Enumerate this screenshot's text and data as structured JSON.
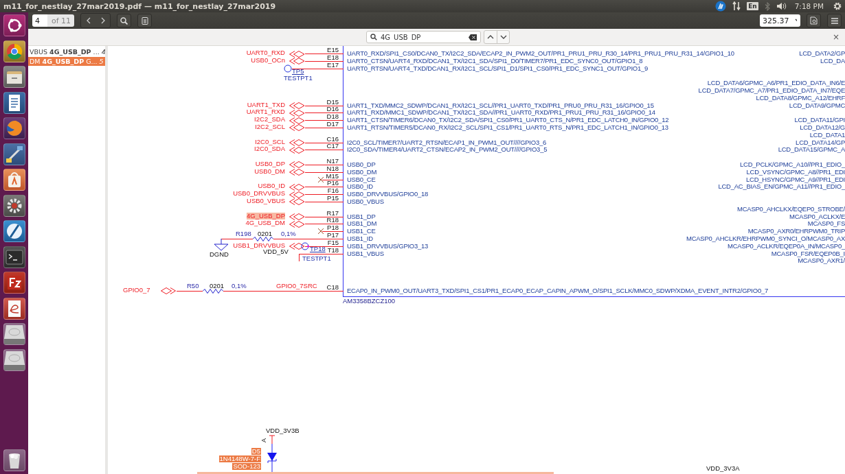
{
  "window": {
    "title": "m11_for_nestlay_27mar2019.pdf — m11_for_nestlay_27mar2019"
  },
  "indicators": {
    "keyboard": "En",
    "clock": "7:18 PM"
  },
  "toolbar": {
    "page": "4",
    "page_count": "of 11",
    "zoom": "325.37"
  },
  "find_bar": {
    "query": "4G_USB_DP",
    "close": "×"
  },
  "results": [
    {
      "text": "VBUS **4G_USB_DP** ...",
      "page": "4",
      "selected": false
    },
    {
      "text": "DM **4G_USB_DP** G...",
      "page": "5",
      "selected": true
    }
  ],
  "schematic": {
    "rows": [
      {
        "kind": "net",
        "net": "UART0_RXD",
        "search_match": false,
        "pin": "E15",
        "pin_name": "UART0_RXD/SPI1_CS0/DCAN0_TX/I2C2_SDA/ECAP2_IN_PWM2_OUT/PR1_PRU1_PRU_R30_14/PR1_PRU1_PRU_R31_14/GPIO1_10",
        "right": "LCD_DATA2/GP"
      },
      {
        "kind": "net",
        "net": "USB0_OCn",
        "search_match": false,
        "pin": "E18",
        "pin_name": "UART0_CTSN/UART4_RXD/DCAN1_TX/I2C1_SDA/SPI1_D0/TIMER7/PR1_EDC_SYNC0_OUT/GPIO1_8",
        "right": "LCD_DA"
      },
      {
        "kind": "testpoint",
        "testpoint": "TP5",
        "testpoint_type": "TESTPT1",
        "pin": "E17",
        "pin_name": "UART0_RTSN/UART4_TXD/DCAN1_RX/I2C1_SCL/SPI1_D1/SPI1_CS0/PR1_EDC_SYNC1_OUT/GPIO1_9"
      },
      {
        "kind": "blank"
      },
      {
        "kind": "blank",
        "right": "LCD_DATA6/GPMC_A6/PR1_EDIO_DATA_IN6/E"
      },
      {
        "kind": "blank",
        "right": "LCD_DATA7/GPMC_A7/PR1_EDIO_DATA_IN7/EQE"
      },
      {
        "kind": "blank",
        "right": "LCD_DATA8/GPMC_A12/EHRF"
      },
      {
        "kind": "net",
        "net": "UART1_TXD",
        "search_match": false,
        "pin": "D15",
        "pin_name": "UART1_TXD/MMC2_SDWP/DCAN1_RX/I2C1_SCL//PR1_UART0_TXD/PR1_PRU0_PRU_R31_16/GPIO0_15",
        "right": "LCD_DATA9/GPMC"
      },
      {
        "kind": "net",
        "net": "UART1_RXD",
        "search_match": false,
        "pin": "D16",
        "pin_name": "UART1_RXD/MMC1_SDWP/DCAN1_TX/I2C1_SDA//PR1_UART0_RXD/PR1_PRU1_PRU_R31_16/GPIO0_14"
      },
      {
        "kind": "net",
        "net": "I2C2_SDA",
        "search_match": false,
        "pin": "D18",
        "pin_name": "UART1_CTSN/TIMER6/DCAN0_TX/I2C2_SDA/SPI1_CS0/PR1_UART0_CTS_N/PR1_EDC_LATCH0_IN/GPIO0_12",
        "right": "LCD_DATA11/GPI"
      },
      {
        "kind": "net",
        "net": "I2C2_SCL",
        "search_match": false,
        "pin": "D17",
        "pin_name": "UART1_RTSN/TIMER5/DCAN0_RX/I2C2_SCL/SPI1_CS1/PR1_UART0_RTS_N/PR1_EDC_LATCH1_IN/GPIO0_13",
        "right": "LCD_DATA12/G"
      },
      {
        "kind": "blank",
        "right": "LCD_DATA1"
      },
      {
        "kind": "net",
        "net": "I2C0_SCL",
        "search_match": false,
        "pin": "C16",
        "pin_name": "I2C0_SCL/TIMER7/UART2_RTSN/ECAP1_IN_PWM1_OUT////GPIO3_6",
        "right": "LCD_DATA14/GP"
      },
      {
        "kind": "net",
        "net": "I2C0_SDA",
        "search_match": false,
        "pin": "C17",
        "pin_name": "I2C0_SDA/TIMER4/UART2_CTSN/ECAP2_IN_PWM2_OUT////GPIO3_5",
        "right": "LCD_DATA15/GPMC_A"
      },
      {
        "kind": "blank"
      },
      {
        "kind": "net",
        "net": "USB0_DP",
        "search_match": false,
        "pin": "N17",
        "pin_name": "USB0_DP",
        "right": "LCD_PCLK/GPMC_A10//PR1_EDIO_"
      },
      {
        "kind": "net",
        "net": "USB0_DM",
        "search_match": false,
        "pin": "N18",
        "pin_name": "USB0_DM",
        "right": "LCD_VSYNC/GPMC_A8//PR1_EDI"
      },
      {
        "kind": "nc",
        "pin": "M15",
        "pin_name": "USB0_CE",
        "right": "LCD_HSYNC/GPMC_A9//PR1_EDI"
      },
      {
        "kind": "net",
        "net": "USB0_ID",
        "search_match": false,
        "pin": "P16",
        "pin_name": "USB0_ID",
        "right": "LCD_AC_BIAS_EN/GPMC_A11//PR1_EDIO_"
      },
      {
        "kind": "net",
        "net": "USB0_DRVVBUS",
        "search_match": false,
        "pin": "F16",
        "pin_name": "USB0_DRVVBUS/GPIO0_18"
      },
      {
        "kind": "net",
        "net": "USB0_VBUS",
        "search_match": false,
        "pin": "P15",
        "pin_name": "USB0_VBUS"
      },
      {
        "kind": "blank",
        "right": "MCASP0_AHCLKX/EQEP0_STROBE/"
      },
      {
        "kind": "net",
        "net": "4G_USB_DP",
        "search_match": true,
        "pin": "R17",
        "pin_name": "USB1_DP",
        "right": "MCASP0_ACLKX/E"
      },
      {
        "kind": "net",
        "net": "4G_USB_DM",
        "search_match": false,
        "pin": "R18",
        "pin_name": "USB1_DM",
        "right": "MCASP0_FS"
      },
      {
        "kind": "nc",
        "pin": "P18",
        "pin_name": "USB1_CE",
        "right": "MCASP0_AXR0/EHRPWM0_TRIP"
      },
      {
        "kind": "resistor",
        "resistor": {
          "ref": "R198",
          "package": "0201",
          "tolerance": "0,1%"
        },
        "ground": "DGND",
        "pin": "P17",
        "pin_name": "USB1_ID",
        "right": "MCASP0_AHCLKR/EHRPWM0_SYNCI_O/MCASP0_AX"
      },
      {
        "kind": "net",
        "net": "USB1_DRVVBUS",
        "search_match": false,
        "testpoint": "TP18",
        "pin": "F15",
        "pin_name": "USB1_DRVVBUS/GPIO3_13",
        "right": "MCASP0_ACLKR/EQEP0A_IN/MCASP0_"
      },
      {
        "kind": "stub",
        "supply": "VDD_5V",
        "testpoint_type": "TESTPT1",
        "pin": "T18",
        "pin_name": "USB1_VBUS",
        "right": "MCASP0_FSR/EQEP0B_I"
      },
      {
        "kind": "blank",
        "right": "MCASP0_AXR1/"
      },
      {
        "kind": "blank"
      },
      {
        "kind": "blank"
      },
      {
        "kind": "blank"
      },
      {
        "kind": "series_resistor",
        "net": "GPIO0_7",
        "resistor": {
          "ref": "R50",
          "package": "0201",
          "tolerance": "0,1%"
        },
        "signal": "GPIO0_7SRC",
        "pin": "C18",
        "pin_name": "ECAP0_IN_PWM0_OUT/UART3_TXD/SPI1_CS1/PR1_ECAP0_ECAP_CAPIN_APWM_O/SPI1_SCLK/MMC0_SDWP/XDMA_EVENT_INTR2/GPIO0_7"
      }
    ],
    "part_number": "AM3358BZCZ100",
    "diode": {
      "supply": "VDD_3V3B",
      "anode": "A",
      "ref": "D5",
      "part": "1N4148W-7-F",
      "package": "SOD-123"
    },
    "bottom_net": "VDD_3V3A"
  }
}
